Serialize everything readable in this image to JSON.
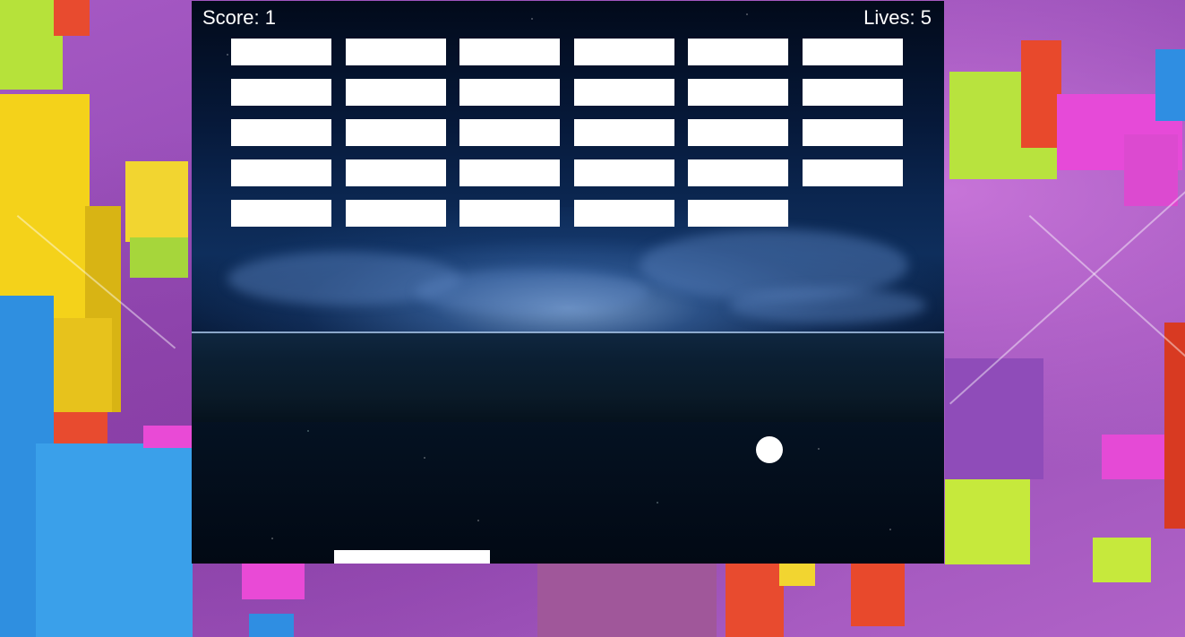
{
  "hud": {
    "score_label": "Score: 1",
    "lives_label": "Lives: 5",
    "score": 1,
    "lives": 5
  },
  "bricks": {
    "rows": [
      [
        true,
        true,
        true,
        true,
        true,
        true
      ],
      [
        true,
        true,
        true,
        true,
        true,
        true
      ],
      [
        true,
        true,
        true,
        true,
        true,
        true
      ],
      [
        true,
        true,
        true,
        true,
        true,
        true
      ],
      [
        true,
        true,
        true,
        true,
        true,
        false
      ]
    ]
  },
  "colors": {
    "brick": "#ffffff",
    "ball": "#ffffff",
    "paddle": "#ffffff",
    "hud_text": "#ffffff"
  }
}
